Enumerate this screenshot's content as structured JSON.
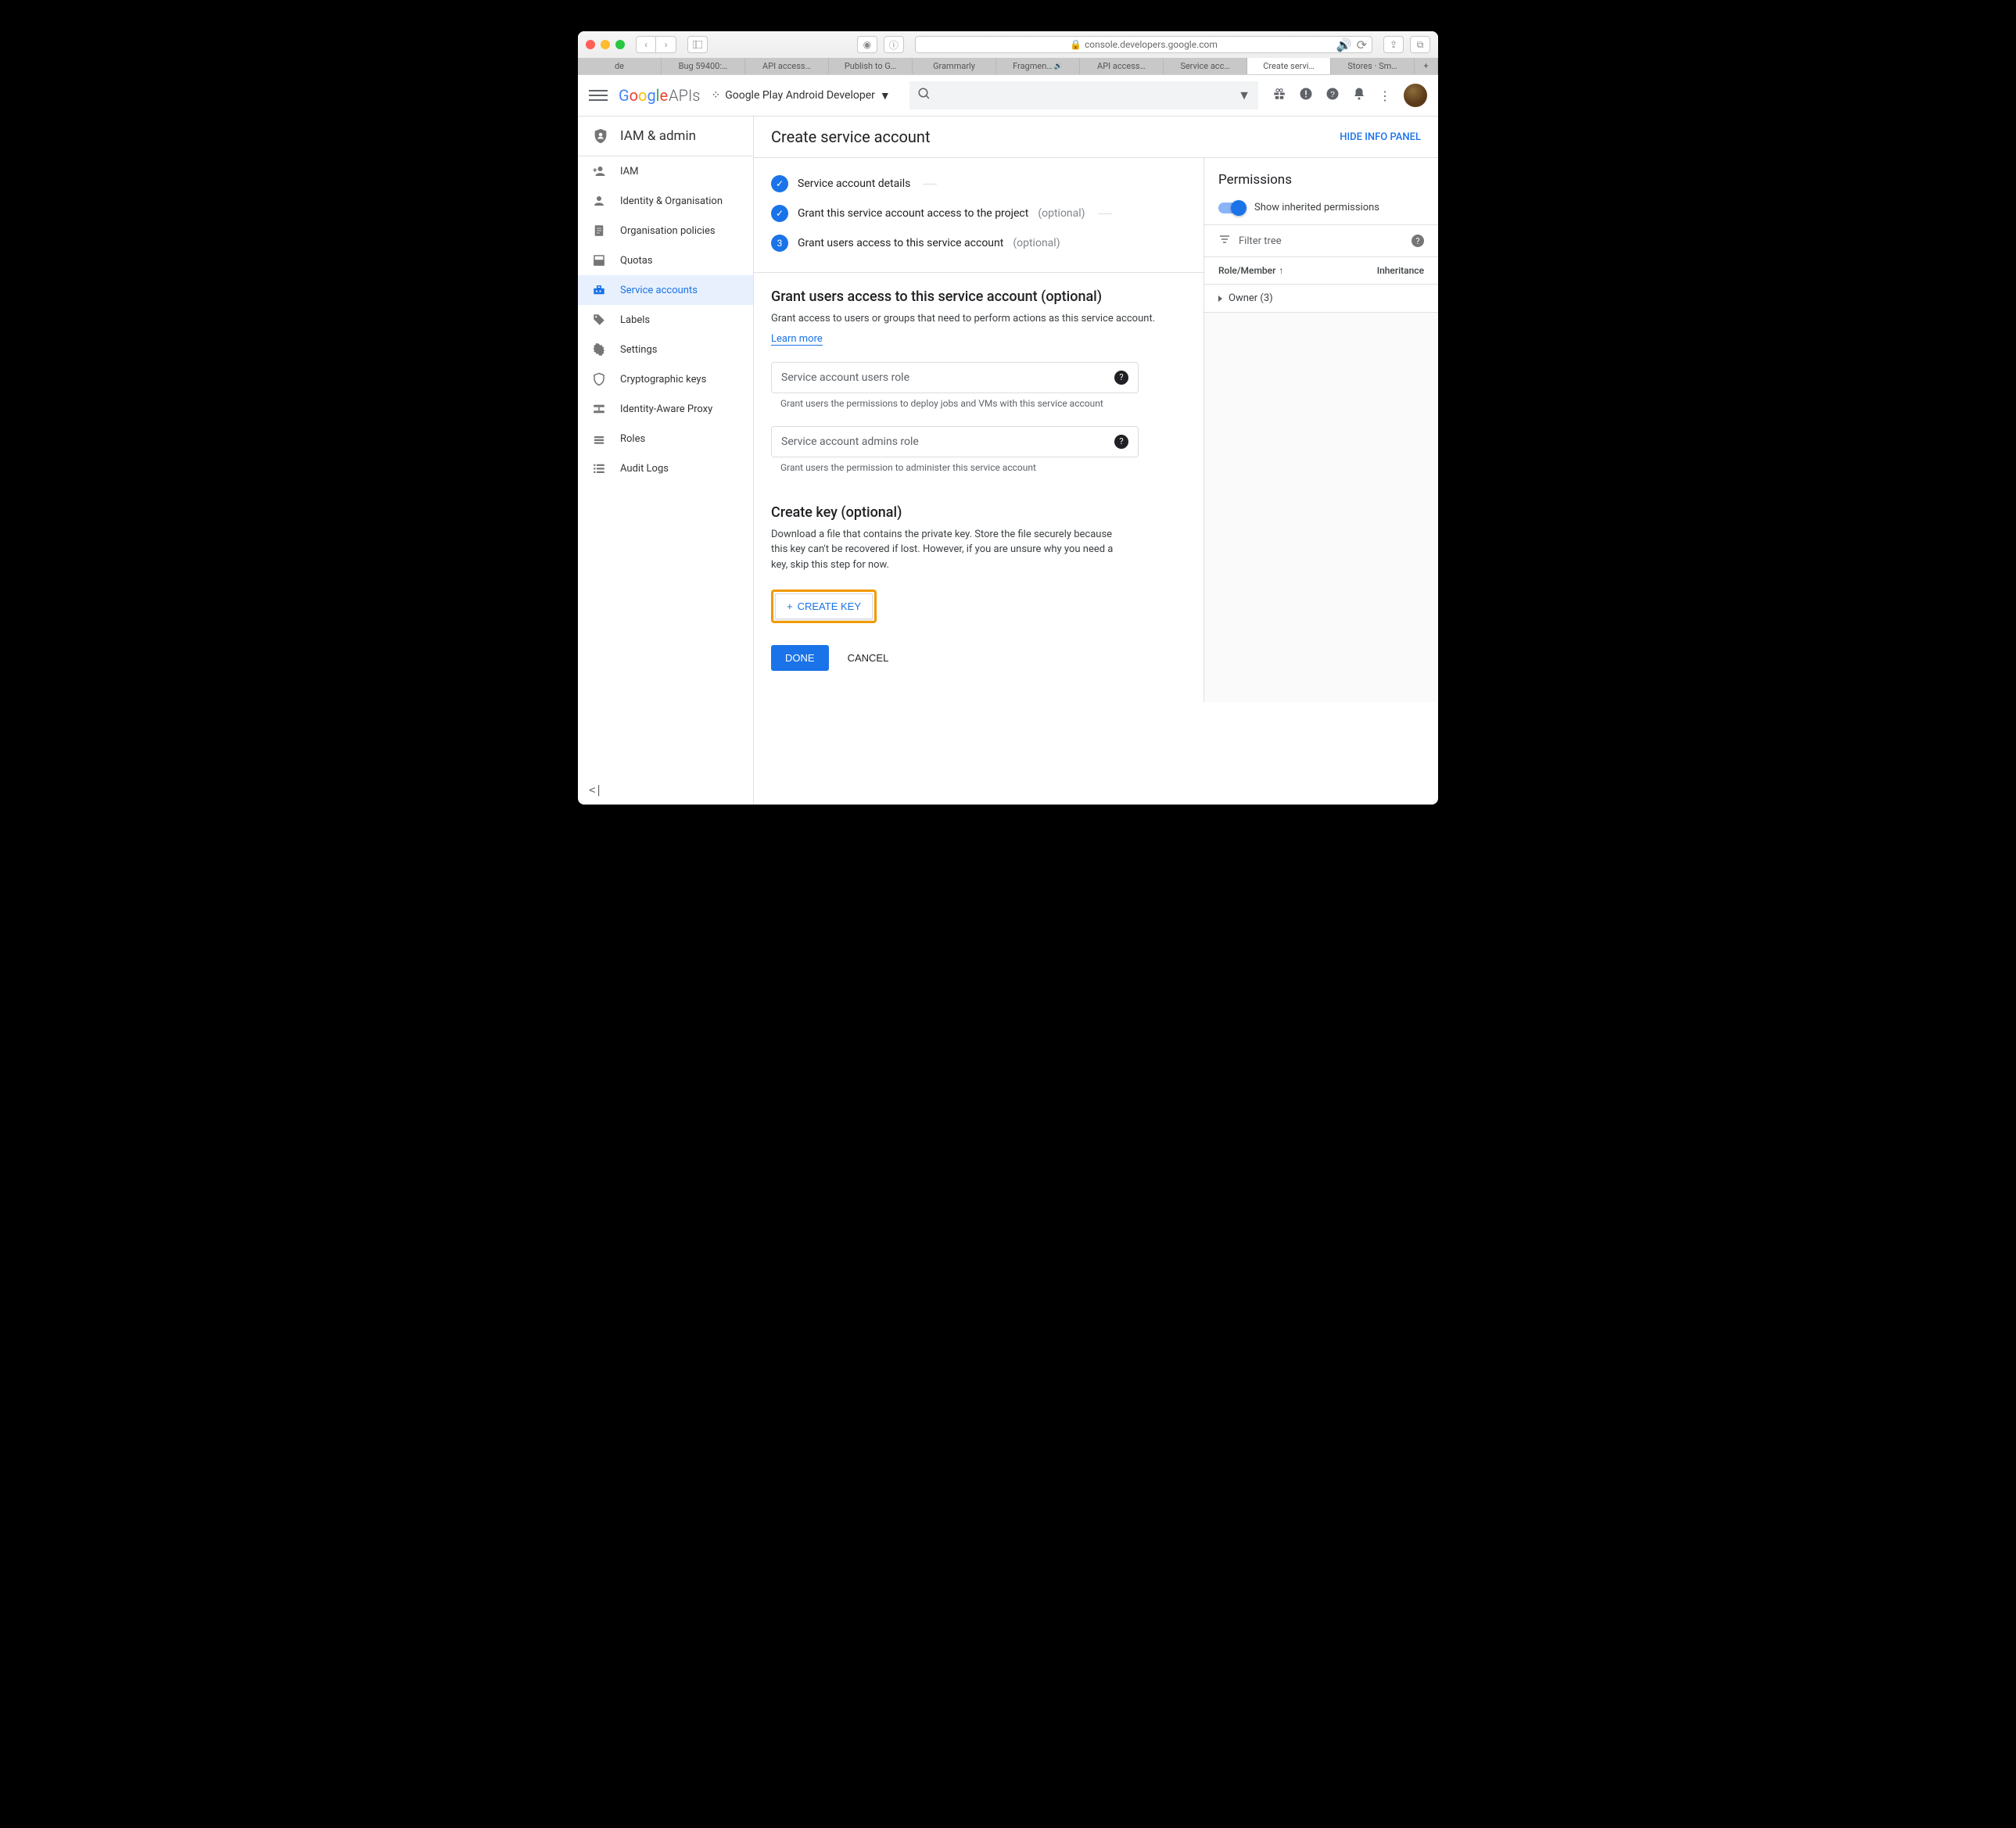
{
  "browser": {
    "url": "console.developers.google.com",
    "tabs": [
      "de",
      "Bug 59400:…",
      "API access…",
      "Publish to G…",
      "Grammarly",
      "Fragmen…",
      "API access…",
      "Service acc…",
      "Create servi…",
      "Stores · Sm…"
    ],
    "active_tab_index": 8
  },
  "header": {
    "logo_brand": "Google",
    "logo_suffix": "APIs",
    "project": "Google Play Android Developer"
  },
  "sidebar": {
    "section": "IAM & admin",
    "items": [
      {
        "label": "IAM"
      },
      {
        "label": "Identity & Organisation"
      },
      {
        "label": "Organisation policies"
      },
      {
        "label": "Quotas"
      },
      {
        "label": "Service accounts"
      },
      {
        "label": "Labels"
      },
      {
        "label": "Settings"
      },
      {
        "label": "Cryptographic keys"
      },
      {
        "label": "Identity-Aware Proxy"
      },
      {
        "label": "Roles"
      },
      {
        "label": "Audit Logs"
      }
    ],
    "active_index": 4
  },
  "main": {
    "title": "Create service account",
    "hide_panel": "HIDE INFO PANEL",
    "steps": {
      "s1": {
        "label": "Service account details"
      },
      "s2": {
        "label": "Grant this service account access to the project",
        "opt": "(optional)"
      },
      "s3": {
        "num": "3",
        "label": "Grant users access to this service account",
        "opt": "(optional)"
      }
    },
    "grant_section": {
      "title": "Grant users access to this service account (optional)",
      "desc": "Grant access to users or groups that need to perform actions as this service account.",
      "learn": "Learn more",
      "field1": {
        "placeholder": "Service account users role",
        "hint": "Grant users the permissions to deploy jobs and VMs with this service account"
      },
      "field2": {
        "placeholder": "Service account admins role",
        "hint": "Grant users the permission to administer this service account"
      }
    },
    "key_section": {
      "title": "Create key (optional)",
      "desc": "Download a file that contains the private key. Store the file securely because this key can't be recovered if lost. However, if you are unsure why you need a key, skip this step for now.",
      "button": "CREATE KEY"
    },
    "actions": {
      "done": "DONE",
      "cancel": "CANCEL"
    }
  },
  "permissions": {
    "title": "Permissions",
    "toggle": "Show inherited permissions",
    "filter_placeholder": "Filter tree",
    "col1": "Role/Member",
    "col2": "Inheritance",
    "row1": "Owner (3)"
  }
}
